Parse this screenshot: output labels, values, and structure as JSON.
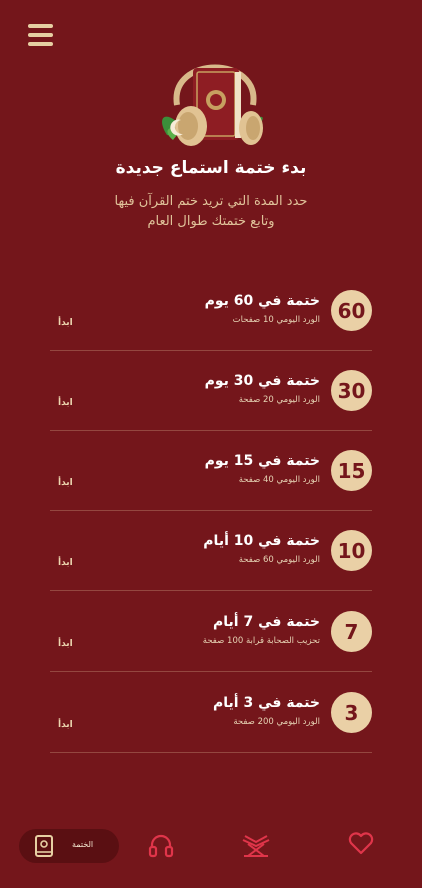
{
  "header": {
    "title": "بدء ختمة استماع جديدة",
    "subtitle_line1": "حدد المدة التي تريد ختم القرآن فيها",
    "subtitle_line2": "وتابع ختمتك طوال العام"
  },
  "plans": [
    {
      "days": "60",
      "title": "ختمة في 60 يوم",
      "daily": "الورد اليومي 10 صفحات",
      "start": "ابدأ"
    },
    {
      "days": "30",
      "title": "ختمة في 30 يوم",
      "daily": "الورد اليومي 20 صفحة",
      "start": "ابدأ"
    },
    {
      "days": "15",
      "title": "ختمة في 15 يوم",
      "daily": "الورد اليومي 40 صفحة",
      "start": "ابدأ"
    },
    {
      "days": "10",
      "title": "ختمة في 10 أيام",
      "daily": "الورد اليومي 60 صفحة",
      "start": "ابدأ"
    },
    {
      "days": "7",
      "title": "ختمة في 7 أيام",
      "daily": "تحزيب الصحابة قرابة 100 صفحة",
      "start": "ابدأ"
    },
    {
      "days": "3",
      "title": "ختمة في 3 أيام",
      "daily": "الورد اليومي 200 صفحة",
      "start": "ابدأ"
    }
  ],
  "nav": {
    "active_label": "الختمة",
    "items": [
      "book-icon",
      "headphones-icon",
      "quran-stand-icon",
      "heart-icon"
    ]
  },
  "colors": {
    "background": "#74161b",
    "accent": "#ead0a6",
    "nav_accent": "#e0354a"
  }
}
